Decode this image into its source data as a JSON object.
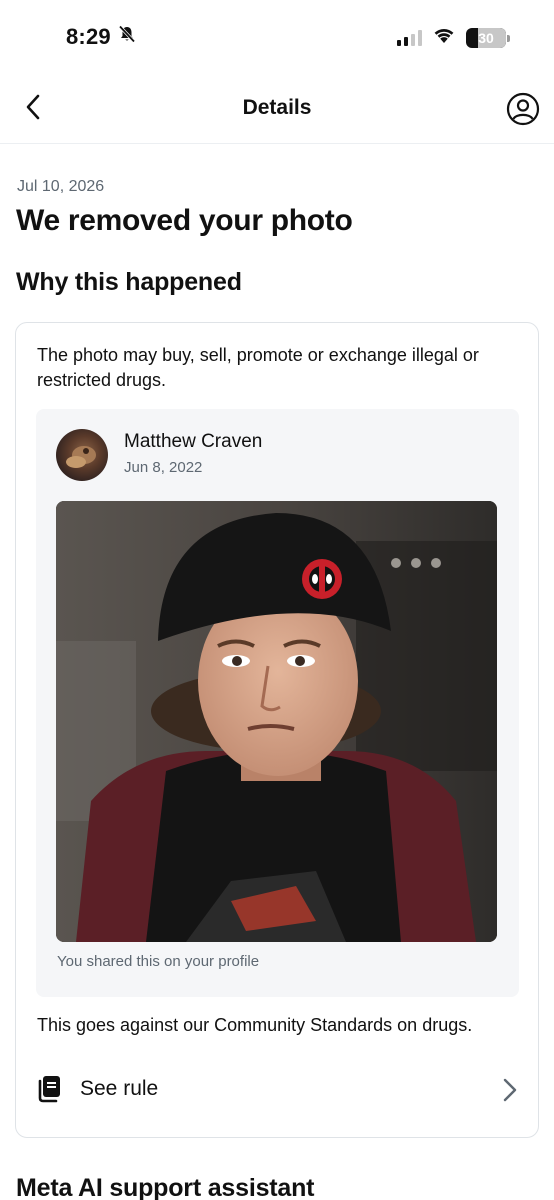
{
  "status_bar": {
    "time": "8:29",
    "battery": "30",
    "icons": [
      "bell-slash-icon",
      "signal-icon",
      "wifi-icon",
      "battery-icon"
    ]
  },
  "nav": {
    "title": "Details",
    "icons": [
      "back-chevron-icon",
      "account-icon"
    ]
  },
  "notice": {
    "date": "Jul 10, 2026",
    "headline": "We removed your photo",
    "section_title": "Why this happened",
    "reason": "The photo may buy, sell, promote or exchange illegal or restricted drugs."
  },
  "post": {
    "author": "Matthew Craven",
    "date": "Jun 8, 2022",
    "shared_note": "You shared this on your profile"
  },
  "policy": {
    "standards_text": "This goes against our Community Standards on drugs.",
    "see_rule_label": "See rule",
    "icons": [
      "rulebook-icon",
      "chevron-right-icon"
    ]
  },
  "next_section": {
    "title": "Meta AI support assistant"
  },
  "colors": {
    "text_primary": "#111111",
    "text_secondary": "#5e6872",
    "card_border": "#dfe3e7",
    "post_background": "#f5f6f8"
  }
}
